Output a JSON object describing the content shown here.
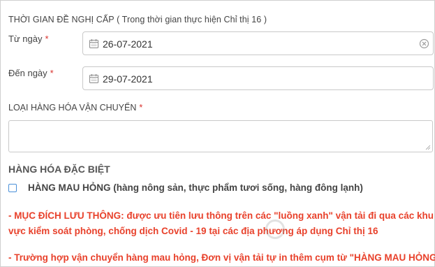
{
  "section_title": "THỜI GIAN ĐỀ NGHỊ CẤP ( Trong thời gian thực hiện Chỉ thị 16 )",
  "from_date": {
    "label": "Từ ngày",
    "required": "*",
    "value": "26-07-2021"
  },
  "to_date": {
    "label": "Đến ngày",
    "required": "*",
    "value": "29-07-2021"
  },
  "cargo_type": {
    "label": "LOẠI HÀNG HÓA VẬN CHUYỂN",
    "required": "*",
    "value": ""
  },
  "special_goods": {
    "title": "HÀNG HÓA ĐẶC BIỆT",
    "perishable_label": "HÀNG MAU HỎNG (hàng nông sản, thực phẩm tươi sống, hàng đông lạnh)",
    "checked": false
  },
  "notes": {
    "line1": "- MỤC ĐÍCH LƯU THÔNG: được ưu tiên lưu thông trên các \"luồng xanh\" vận tải đi qua các khu",
    "line2": "vực kiểm soát phòng, chống dịch Covid - 19 tại các địa phương áp dụng Chỉ thị 16",
    "line3": "- Trường hợp vận chuyển hàng mau hỏng, Đơn vị vận tải tự in thêm cụm từ \"HÀNG MAU HỎNG\""
  },
  "icons": {
    "calendar": "calendar-icon",
    "clear": "clear-icon",
    "resize": "resize-handle-icon"
  },
  "colors": {
    "required": "#d9302c",
    "note_red": "#e8412b",
    "checkbox_border": "#4a90d9"
  }
}
